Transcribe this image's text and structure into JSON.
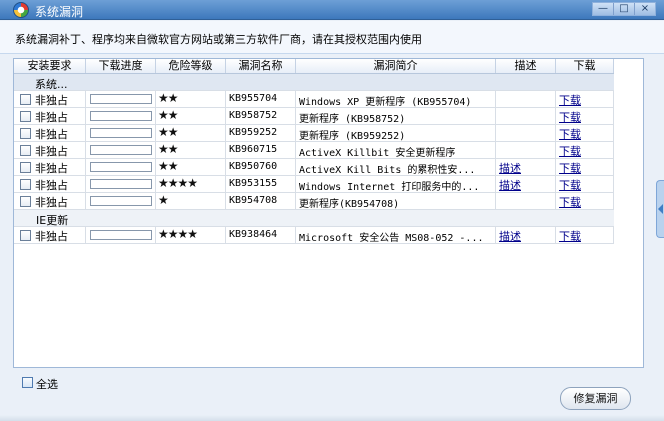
{
  "window": {
    "title": "系统漏洞",
    "minimize_label": "—",
    "maximize_label": "□",
    "close_label": "×"
  },
  "banner": {
    "text": "系统漏洞补丁、程序均来自微软官方网站或第三方软件厂商，请在其授权范围内使用"
  },
  "table": {
    "headers": [
      "安装要求",
      "下载进度",
      "危险等级",
      "漏洞名称",
      "漏洞简介",
      "描述",
      "下载"
    ],
    "groups": {
      "system": "系统...",
      "ie": "IE更新"
    },
    "rows": [
      {
        "mode": "非独占",
        "stars": "★★",
        "kb": "KB955704",
        "desc": "Windows XP 更新程序 (KB955704)",
        "describe": "",
        "download": "下载"
      },
      {
        "mode": "非独占",
        "stars": "★★",
        "kb": "KB958752",
        "desc": "更新程序 (KB958752)",
        "describe": "",
        "download": "下载"
      },
      {
        "mode": "非独占",
        "stars": "★★",
        "kb": "KB959252",
        "desc": "更新程序 (KB959252)",
        "describe": "",
        "download": "下载"
      },
      {
        "mode": "非独占",
        "stars": "★★",
        "kb": "KB960715",
        "desc": "ActiveX Killbit 安全更新程序",
        "describe": "",
        "download": "下载"
      },
      {
        "mode": "非独占",
        "stars": "★★",
        "kb": "KB950760",
        "desc": "ActiveX Kill Bits 的累积性安...",
        "describe": "描述",
        "download": "下载"
      },
      {
        "mode": "非独占",
        "stars": "★★★★",
        "kb": "KB953155",
        "desc": "Windows Internet 打印服务中的...",
        "describe": "描述",
        "download": "下载"
      },
      {
        "mode": "非独占",
        "stars": "★",
        "kb": "KB954708",
        "desc": "更新程序(KB954708)",
        "describe": "",
        "download": "下载"
      },
      {
        "mode": "非独占",
        "stars": "★★★★",
        "kb": "KB938464",
        "desc": "Microsoft 安全公告 MS08-052 -...",
        "describe": "描述",
        "download": "下载"
      }
    ]
  },
  "footer": {
    "select_all": "全选",
    "repair_button": "修复漏洞"
  }
}
